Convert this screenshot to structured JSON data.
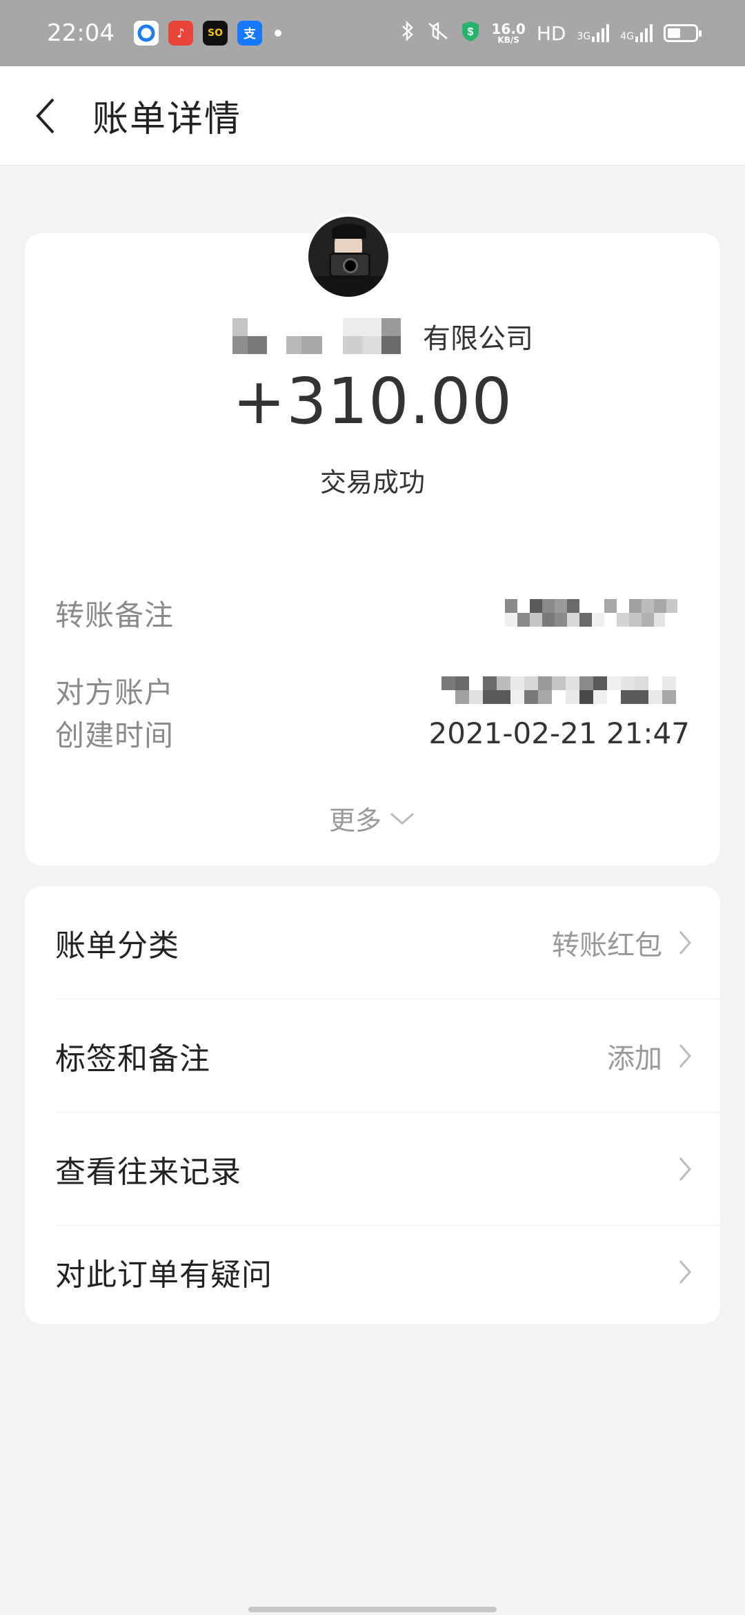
{
  "status_bar": {
    "time": "22:04",
    "net_speed_value": "16.0",
    "net_speed_unit": "KB/S",
    "hd_label": "HD",
    "signal1_label": "3G",
    "signal2_label": "4G",
    "apps": [
      {
        "icon": "circle-app-icon",
        "color": "#1e7df0"
      },
      {
        "icon": "music-app-icon",
        "color": "#e8443a"
      },
      {
        "icon": "solo-app-icon",
        "color": "#111111"
      },
      {
        "icon": "alipay-app-icon",
        "color": "#1677ff"
      }
    ]
  },
  "header": {
    "title": "账单详情",
    "back_icon": "chevron-left-icon"
  },
  "transaction": {
    "counterparty_suffix": "有限公司",
    "amount": "+310.00",
    "status": "交易成功",
    "rows": [
      {
        "label": "转账备注",
        "value": ""
      },
      {
        "label": "对方账户",
        "value": ""
      },
      {
        "label": "创建时间",
        "value": "2021-02-21 21:47"
      }
    ],
    "more_label": "更多"
  },
  "menu": {
    "items": [
      {
        "label": "账单分类",
        "value": "转账红包"
      },
      {
        "label": "标签和备注",
        "value": "添加"
      },
      {
        "label": "查看往来记录",
        "value": ""
      },
      {
        "label": "对此订单有疑问",
        "value": ""
      }
    ]
  },
  "colors": {
    "background": "#f3f3f3",
    "card": "#ffffff",
    "status_bar": "#a7a7a7",
    "accent_green": "#27b36a"
  }
}
